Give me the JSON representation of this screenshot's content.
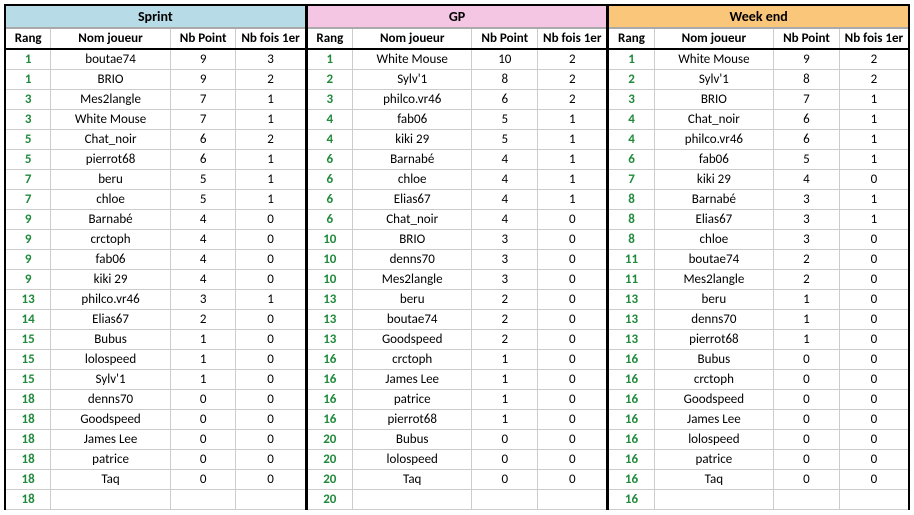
{
  "sections": [
    {
      "title": "Sprint",
      "titleClass": "title-sprint",
      "headers": [
        "Rang",
        "Nom joueur",
        "Nb Point",
        "Nb fois 1er"
      ],
      "rows": [
        {
          "rang": "1",
          "joueur": "boutae74",
          "pts": "9",
          "fois": "3"
        },
        {
          "rang": "1",
          "joueur": "BRIO",
          "pts": "9",
          "fois": "2"
        },
        {
          "rang": "3",
          "joueur": "Mes2langle",
          "pts": "7",
          "fois": "1"
        },
        {
          "rang": "3",
          "joueur": "White Mouse",
          "pts": "7",
          "fois": "1"
        },
        {
          "rang": "5",
          "joueur": "Chat_noir",
          "pts": "6",
          "fois": "2"
        },
        {
          "rang": "5",
          "joueur": "pierrot68",
          "pts": "6",
          "fois": "1"
        },
        {
          "rang": "7",
          "joueur": "beru",
          "pts": "5",
          "fois": "1"
        },
        {
          "rang": "7",
          "joueur": "chloe",
          "pts": "5",
          "fois": "1"
        },
        {
          "rang": "9",
          "joueur": "Barnabé",
          "pts": "4",
          "fois": "0"
        },
        {
          "rang": "9",
          "joueur": "crctoph",
          "pts": "4",
          "fois": "0"
        },
        {
          "rang": "9",
          "joueur": "fab06",
          "pts": "4",
          "fois": "0"
        },
        {
          "rang": "9",
          "joueur": "kiki 29",
          "pts": "4",
          "fois": "0"
        },
        {
          "rang": "13",
          "joueur": "philco.vr46",
          "pts": "3",
          "fois": "1"
        },
        {
          "rang": "14",
          "joueur": "Elias67",
          "pts": "2",
          "fois": "0"
        },
        {
          "rang": "15",
          "joueur": "Bubus",
          "pts": "1",
          "fois": "0"
        },
        {
          "rang": "15",
          "joueur": "lolospeed",
          "pts": "1",
          "fois": "0"
        },
        {
          "rang": "15",
          "joueur": "Sylv'1",
          "pts": "1",
          "fois": "0"
        },
        {
          "rang": "18",
          "joueur": "denns70",
          "pts": "0",
          "fois": "0"
        },
        {
          "rang": "18",
          "joueur": "Goodspeed",
          "pts": "0",
          "fois": "0"
        },
        {
          "rang": "18",
          "joueur": "James Lee",
          "pts": "0",
          "fois": "0"
        },
        {
          "rang": "18",
          "joueur": "patrice",
          "pts": "0",
          "fois": "0"
        },
        {
          "rang": "18",
          "joueur": "Taq",
          "pts": "0",
          "fois": "0"
        },
        {
          "rang": "18",
          "joueur": "",
          "pts": "",
          "fois": ""
        }
      ]
    },
    {
      "title": "GP",
      "titleClass": "title-gp",
      "headers": [
        "Rang",
        "Nom joueur",
        "Nb Point",
        "Nb fois 1er"
      ],
      "rows": [
        {
          "rang": "1",
          "joueur": "White Mouse",
          "pts": "10",
          "fois": "2"
        },
        {
          "rang": "2",
          "joueur": "Sylv'1",
          "pts": "8",
          "fois": "2"
        },
        {
          "rang": "3",
          "joueur": "philco.vr46",
          "pts": "6",
          "fois": "2"
        },
        {
          "rang": "4",
          "joueur": "fab06",
          "pts": "5",
          "fois": "1"
        },
        {
          "rang": "4",
          "joueur": "kiki 29",
          "pts": "5",
          "fois": "1"
        },
        {
          "rang": "6",
          "joueur": "Barnabé",
          "pts": "4",
          "fois": "1"
        },
        {
          "rang": "6",
          "joueur": "chloe",
          "pts": "4",
          "fois": "1"
        },
        {
          "rang": "6",
          "joueur": "Elias67",
          "pts": "4",
          "fois": "1"
        },
        {
          "rang": "6",
          "joueur": "Chat_noir",
          "pts": "4",
          "fois": "0"
        },
        {
          "rang": "10",
          "joueur": "BRIO",
          "pts": "3",
          "fois": "0"
        },
        {
          "rang": "10",
          "joueur": "denns70",
          "pts": "3",
          "fois": "0"
        },
        {
          "rang": "10",
          "joueur": "Mes2langle",
          "pts": "3",
          "fois": "0"
        },
        {
          "rang": "13",
          "joueur": "beru",
          "pts": "2",
          "fois": "0"
        },
        {
          "rang": "13",
          "joueur": "boutae74",
          "pts": "2",
          "fois": "0"
        },
        {
          "rang": "13",
          "joueur": "Goodspeed",
          "pts": "2",
          "fois": "0"
        },
        {
          "rang": "16",
          "joueur": "crctoph",
          "pts": "1",
          "fois": "0"
        },
        {
          "rang": "16",
          "joueur": "James Lee",
          "pts": "1",
          "fois": "0"
        },
        {
          "rang": "16",
          "joueur": "patrice",
          "pts": "1",
          "fois": "0"
        },
        {
          "rang": "16",
          "joueur": "pierrot68",
          "pts": "1",
          "fois": "0"
        },
        {
          "rang": "20",
          "joueur": "Bubus",
          "pts": "0",
          "fois": "0"
        },
        {
          "rang": "20",
          "joueur": "lolospeed",
          "pts": "0",
          "fois": "0"
        },
        {
          "rang": "20",
          "joueur": "Taq",
          "pts": "0",
          "fois": "0"
        },
        {
          "rang": "20",
          "joueur": "",
          "pts": "",
          "fois": ""
        }
      ]
    },
    {
      "title": "Week end",
      "titleClass": "title-weekend",
      "headers": [
        "Rang",
        "Nom joueur",
        "Nb Point",
        "Nb fois 1er"
      ],
      "rows": [
        {
          "rang": "1",
          "joueur": "White Mouse",
          "pts": "9",
          "fois": "2"
        },
        {
          "rang": "2",
          "joueur": "Sylv'1",
          "pts": "8",
          "fois": "2"
        },
        {
          "rang": "3",
          "joueur": "BRIO",
          "pts": "7",
          "fois": "1"
        },
        {
          "rang": "4",
          "joueur": "Chat_noir",
          "pts": "6",
          "fois": "1"
        },
        {
          "rang": "4",
          "joueur": "philco.vr46",
          "pts": "6",
          "fois": "1"
        },
        {
          "rang": "6",
          "joueur": "fab06",
          "pts": "5",
          "fois": "1"
        },
        {
          "rang": "7",
          "joueur": "kiki 29",
          "pts": "4",
          "fois": "0"
        },
        {
          "rang": "8",
          "joueur": "Barnabé",
          "pts": "3",
          "fois": "1"
        },
        {
          "rang": "8",
          "joueur": "Elias67",
          "pts": "3",
          "fois": "1"
        },
        {
          "rang": "8",
          "joueur": "chloe",
          "pts": "3",
          "fois": "0"
        },
        {
          "rang": "11",
          "joueur": "boutae74",
          "pts": "2",
          "fois": "0"
        },
        {
          "rang": "11",
          "joueur": "Mes2langle",
          "pts": "2",
          "fois": "0"
        },
        {
          "rang": "13",
          "joueur": "beru",
          "pts": "1",
          "fois": "0"
        },
        {
          "rang": "13",
          "joueur": "denns70",
          "pts": "1",
          "fois": "0"
        },
        {
          "rang": "13",
          "joueur": "pierrot68",
          "pts": "1",
          "fois": "0"
        },
        {
          "rang": "16",
          "joueur": "Bubus",
          "pts": "0",
          "fois": "0"
        },
        {
          "rang": "16",
          "joueur": "crctoph",
          "pts": "0",
          "fois": "0"
        },
        {
          "rang": "16",
          "joueur": "Goodspeed",
          "pts": "0",
          "fois": "0"
        },
        {
          "rang": "16",
          "joueur": "James Lee",
          "pts": "0",
          "fois": "0"
        },
        {
          "rang": "16",
          "joueur": "lolospeed",
          "pts": "0",
          "fois": "0"
        },
        {
          "rang": "16",
          "joueur": "patrice",
          "pts": "0",
          "fois": "0"
        },
        {
          "rang": "16",
          "joueur": "Taq",
          "pts": "0",
          "fois": "0"
        },
        {
          "rang": "16",
          "joueur": "",
          "pts": "",
          "fois": ""
        }
      ]
    }
  ]
}
